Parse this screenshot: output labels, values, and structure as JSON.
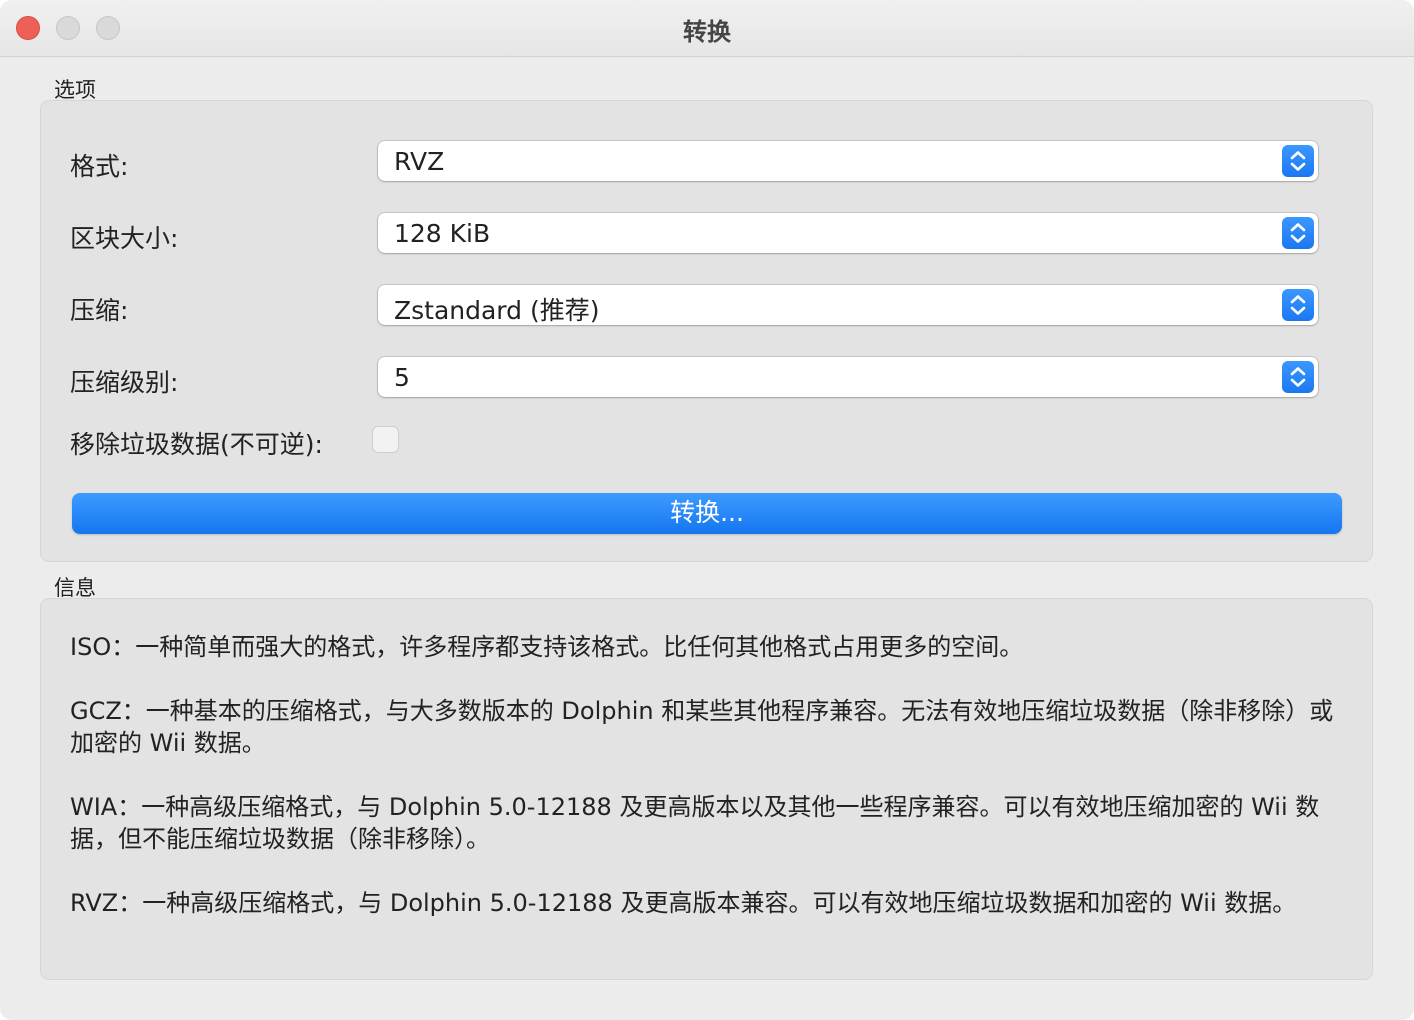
{
  "window": {
    "title": "转换"
  },
  "options_group": {
    "label": "选项",
    "format": {
      "label": "格式:",
      "value": "RVZ"
    },
    "block_size": {
      "label": "区块大小:",
      "value": "128 KiB"
    },
    "compression": {
      "label": "压缩:",
      "value": "Zstandard (推荐)"
    },
    "compression_level": {
      "label": "压缩级别:",
      "value": "5"
    },
    "remove_junk": {
      "label": "移除垃圾数据(不可逆):",
      "checked": false
    },
    "convert_button": "转换..."
  },
  "info_group": {
    "label": "信息",
    "paragraphs": [
      "ISO：一种简单而强大的格式，许多程序都支持该格式。比任何其他格式占用更多的空间。",
      "GCZ：一种基本的压缩格式，与大多数版本的 Dolphin 和某些其他程序兼容。无法有效地压缩垃圾数据（除非移除）或加密的 Wii 数据。",
      "WIA：一种高级压缩格式，与 Dolphin 5.0-12188 及更高版本以及其他一些程序兼容。可以有效地压缩加密的 Wii 数据，但不能压缩垃圾数据（除非移除）。",
      "RVZ：一种高级压缩格式，与 Dolphin 5.0-12188 及更高版本兼容。可以有效地压缩垃圾数据和加密的 Wii 数据。"
    ]
  },
  "colors": {
    "accent": "#1a78f2",
    "close": "#ee5f57",
    "window_bg": "#ececec",
    "group_bg": "#e3e3e3"
  },
  "icons": {
    "popup_arrows": "up-down-chevrons-icon",
    "checkbox": "checkbox-icon"
  }
}
